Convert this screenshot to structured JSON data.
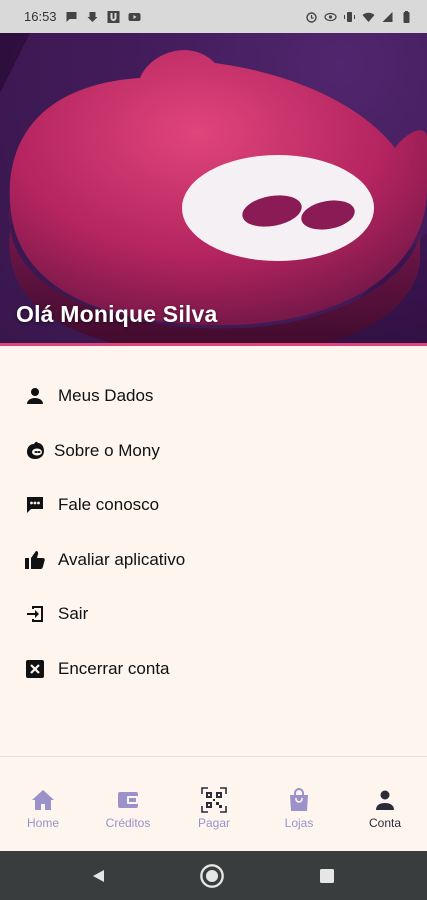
{
  "status_bar": {
    "time": "16:53"
  },
  "hero": {
    "greeting": "Olá Monique Silva"
  },
  "menu": {
    "items": [
      {
        "label": "Meus Dados",
        "icon": "person-icon"
      },
      {
        "label": "Sobre o Mony",
        "icon": "mony-logo-icon"
      },
      {
        "label": "Fale conosco",
        "icon": "chat-icon"
      },
      {
        "label": "Avaliar aplicativo",
        "icon": "thumbs-up-icon"
      },
      {
        "label": "Sair",
        "icon": "logout-icon"
      },
      {
        "label": "Encerrar conta",
        "icon": "close-box-icon"
      }
    ]
  },
  "bottom_nav": {
    "items": [
      {
        "label": "Home",
        "icon": "home-icon"
      },
      {
        "label": "Créditos",
        "icon": "wallet-icon"
      },
      {
        "label": "Pagar",
        "icon": "qr-code-icon"
      },
      {
        "label": "Lojas",
        "icon": "shopping-bag-icon"
      },
      {
        "label": "Conta",
        "icon": "person-icon",
        "active": true
      }
    ],
    "active_color": "#2b2b3a",
    "inactive_color": "#9a92c8"
  },
  "colors": {
    "accent": "#e0457b",
    "background": "#fdf5ee"
  }
}
